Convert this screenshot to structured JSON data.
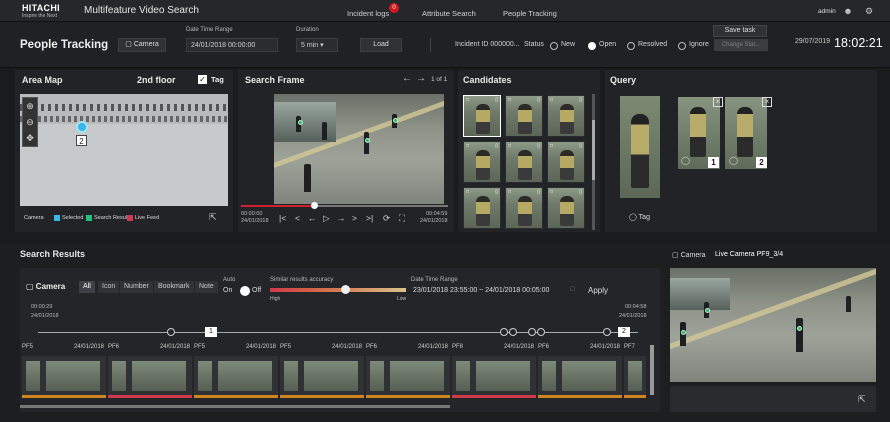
{
  "app": {
    "logo": "HITACHI",
    "logo_tagline": "Inspire the Next",
    "title": "Multifeature Video Search"
  },
  "nav": {
    "incident_logs": "Incident logs",
    "incident_badge": "0",
    "attribute_search": "Attribute Search",
    "people_tracking": "People Tracking",
    "user": "admin"
  },
  "header": {
    "title": "People Tracking",
    "camera_btn": "Camera",
    "date_label": "Date Time Range",
    "date_value": "24/01/2018 00:00:00",
    "duration_label": "Duration",
    "duration_value": "5 min",
    "load": "Load",
    "incident_id": "Incident ID 000000...",
    "status_label": "Status",
    "status_options": [
      "New",
      "Open",
      "Resolved",
      "Ignore"
    ],
    "status_selected": "Open",
    "save_task": "Save task",
    "change_status": "Change Stat...",
    "date": "29/07/2019",
    "time": "18:02:21"
  },
  "area_map": {
    "title": "Area Map",
    "floor": "2nd floor",
    "tag_label": "Tag",
    "camera_number": "2",
    "legend": {
      "camera": "Camera",
      "selected": "Selected",
      "search_result": "Search Result",
      "live_feed": "Live Feed"
    },
    "colors": {
      "selected": "#39b7e6",
      "search_result": "#23c07a",
      "live_feed": "#d0384f"
    }
  },
  "search_frame": {
    "title": "Search Frame",
    "page": "1 of 1",
    "start_time": "00:00:00",
    "start_date": "24/01/2018",
    "end_time": "00:04:59",
    "end_date": "24/01/2018",
    "progress": 0.35
  },
  "candidates": {
    "title": "Candidates",
    "count": 12
  },
  "query": {
    "title": "Query",
    "tag": "Tag",
    "items": [
      {
        "badge": "1"
      },
      {
        "badge": "2"
      }
    ]
  },
  "results": {
    "title": "Search Results",
    "camera_label": "Camera",
    "tabs": [
      "All",
      "Icon",
      "Number",
      "Bookmark",
      "Note"
    ],
    "active_tab": "All",
    "auto_label": "Auto",
    "auto_on": "On",
    "auto_off": "Off",
    "accuracy_label": "Similar results accuracy",
    "acc_high": "High",
    "acc_low": "Low",
    "accuracy_value": 0.55,
    "dtr_label": "Date Time Range",
    "dtr_value": "23/01/2018 23:55:00 ~ 24/01/2018 00:05:00",
    "apply": "Apply",
    "tl_start_time": "00:00:29",
    "tl_start_date": "24/01/2018",
    "tl_end_time": "00:04:58",
    "tl_end_date": "24/01/2018",
    "tl_marker1": "1",
    "tl_marker2": "2",
    "strip": [
      {
        "cam": "PF5",
        "date": "24/01/2018",
        "bar": "#d0841f"
      },
      {
        "cam": "PF6",
        "date": "24/01/2018",
        "bar": "#cf3b4a"
      },
      {
        "cam": "PF5",
        "date": "24/01/2018",
        "bar": "#d0841f"
      },
      {
        "cam": "PF5",
        "date": "24/01/2018",
        "bar": "#d0841f"
      },
      {
        "cam": "PF6",
        "date": "24/01/2018",
        "bar": "#d0841f"
      },
      {
        "cam": "PF8",
        "date": "24/01/2018",
        "bar": "#cf3b4a"
      },
      {
        "cam": "PF6",
        "date": "24/01/2018",
        "bar": "#d0841f"
      },
      {
        "cam": "PF7",
        "date": "",
        "bar": "#d0841f"
      }
    ]
  },
  "live": {
    "camera_label": "Camera",
    "feed_label": "Live Camera PF9_3/4"
  }
}
